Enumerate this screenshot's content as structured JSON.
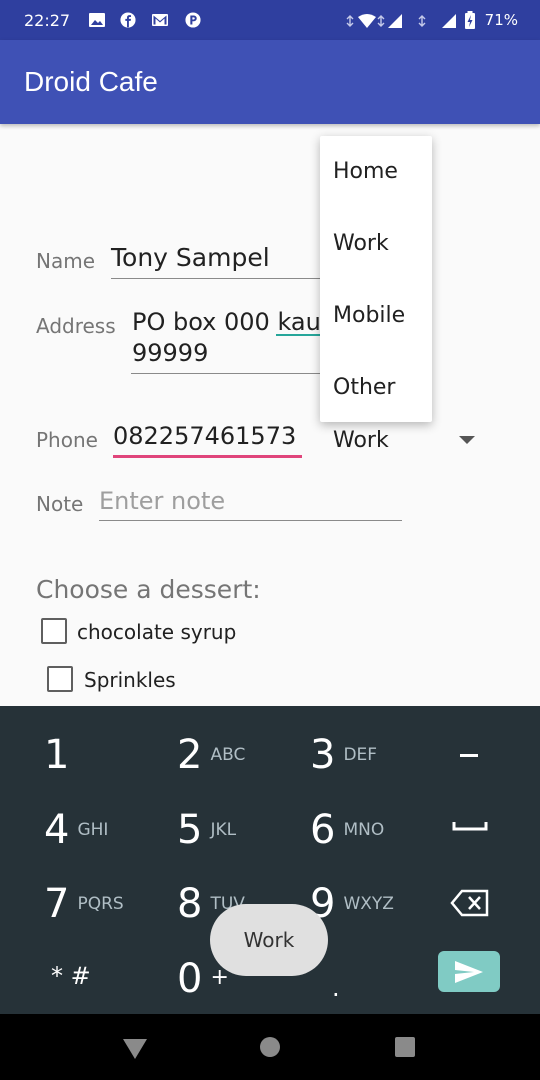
{
  "status_bar": {
    "time": "22:27",
    "battery": "71%",
    "notification_icons": [
      "image-icon",
      "facebook-icon",
      "gmail-icon",
      "p-icon"
    ]
  },
  "app_bar": {
    "title": "Droid Cafe"
  },
  "form": {
    "name_label": "Name",
    "name_value": "Tony Sampel",
    "address_label": "Address",
    "address_line1": "PO box 000 kau",
    "address_line2": "99999",
    "phone_label": "Phone",
    "phone_value": "082257461573",
    "phone_type": "Work",
    "note_label": "Note",
    "note_placeholder": "Enter note"
  },
  "dessert": {
    "heading": "Choose a dessert:",
    "options": [
      {
        "label": "chocolate syrup",
        "checked": false
      },
      {
        "label": "Sprinkles",
        "checked": false
      }
    ]
  },
  "popup_menu": {
    "items": [
      "Home",
      "Work",
      "Mobile",
      "Other"
    ]
  },
  "keyboard": {
    "keys": [
      {
        "num": "1",
        "letters": ""
      },
      {
        "num": "2",
        "letters": "ABC"
      },
      {
        "num": "3",
        "letters": "DEF"
      },
      {
        "num": "–",
        "letters": ""
      },
      {
        "num": "4",
        "letters": "GHI"
      },
      {
        "num": "5",
        "letters": "JKL"
      },
      {
        "num": "6",
        "letters": "MNO"
      },
      {
        "num": "␣",
        "letters": ""
      },
      {
        "num": "7",
        "letters": "PQRS"
      },
      {
        "num": "8",
        "letters": "TUV"
      },
      {
        "num": "9",
        "letters": "WXYZ"
      },
      {
        "num": "",
        "letters": ""
      },
      {
        "num": "* #",
        "letters": ""
      },
      {
        "num": "0",
        "letters": "+"
      },
      {
        "num": ".",
        "letters": ""
      }
    ]
  },
  "toast": {
    "text": "Work"
  },
  "colors": {
    "primary": "#3f51b5",
    "primary_dark": "#2f3f9f",
    "accent_pink": "#e0457b",
    "keyboard_bg": "#263238",
    "enter_key": "#80cbc4"
  }
}
